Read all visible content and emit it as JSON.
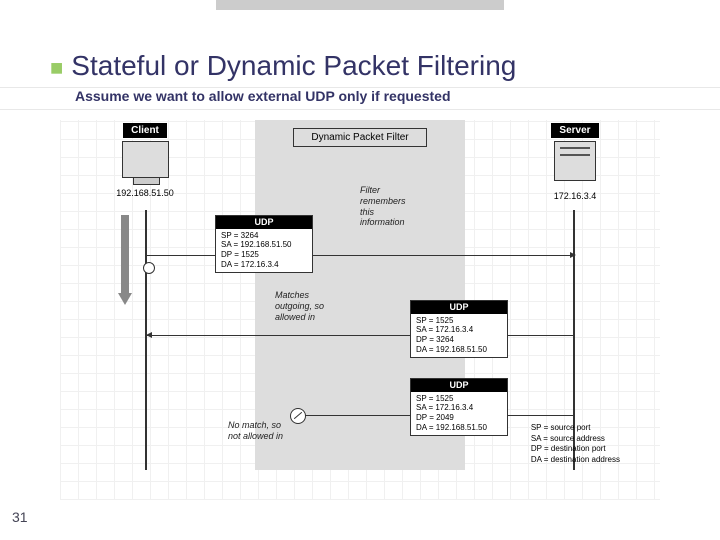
{
  "title": "Stateful or Dynamic Packet Filtering",
  "subtitle": "Assume we want to allow external UDP only if requested",
  "pageNumber": "31",
  "client": {
    "label": "Client",
    "ip": "192.168.51.50"
  },
  "server": {
    "label": "Server",
    "ip": "172.16.3.4"
  },
  "filterBox": {
    "label": "Dynamic Packet Filter"
  },
  "packet1": {
    "hdr": "UDP",
    "sp": "SP = 3264",
    "sa": "SA = 192.168.51.50",
    "dp": "DP = 1525",
    "da": "DA = 172.16.3.4"
  },
  "packet2": {
    "hdr": "UDP",
    "sp": "SP = 1525",
    "sa": "SA = 172.16.3.4",
    "dp": "DP = 3264",
    "da": "DA = 192.168.51.50"
  },
  "packet3": {
    "hdr": "UDP",
    "sp": "SP = 1525",
    "sa": "SA = 172.16.3.4",
    "dp": "DP = 2049",
    "da": "DA = 192.168.51.50"
  },
  "notes": {
    "remember": "Filter\nremembers\nthis\ninformation",
    "match": "Matches\noutgoing, so\nallowed in",
    "nomatch": "No match, so\nnot allowed in"
  },
  "legend": {
    "sp": "SP = source port",
    "sa": "SA = source address",
    "dp": "DP = destination port",
    "da": "DA = destination address"
  }
}
